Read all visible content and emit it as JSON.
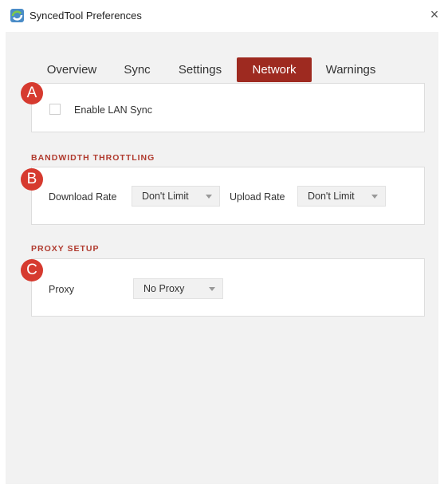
{
  "window": {
    "title": "SyncedTool Preferences",
    "close_glyph": "×",
    "app_icon": "sync-app-icon"
  },
  "tabs": [
    {
      "label": "Overview",
      "active": false
    },
    {
      "label": "Sync",
      "active": false
    },
    {
      "label": "Settings",
      "active": false
    },
    {
      "label": "Network",
      "active": true
    },
    {
      "label": "Warnings",
      "active": false
    }
  ],
  "lan": {
    "badge": "A",
    "checkbox_label": "Enable LAN Sync",
    "checked": false
  },
  "bandwidth": {
    "badge": "B",
    "title": "BANDWIDTH THROTTLING",
    "download_label": "Download Rate",
    "download_value": "Don't Limit",
    "upload_label": "Upload Rate",
    "upload_value": "Don't Limit"
  },
  "proxy": {
    "badge": "C",
    "title": "PROXY SETUP",
    "label": "Proxy",
    "value": "No Proxy"
  },
  "colors": {
    "accent": "#9e2a20",
    "badge": "#d63a2f",
    "section_title": "#b03a2e"
  }
}
